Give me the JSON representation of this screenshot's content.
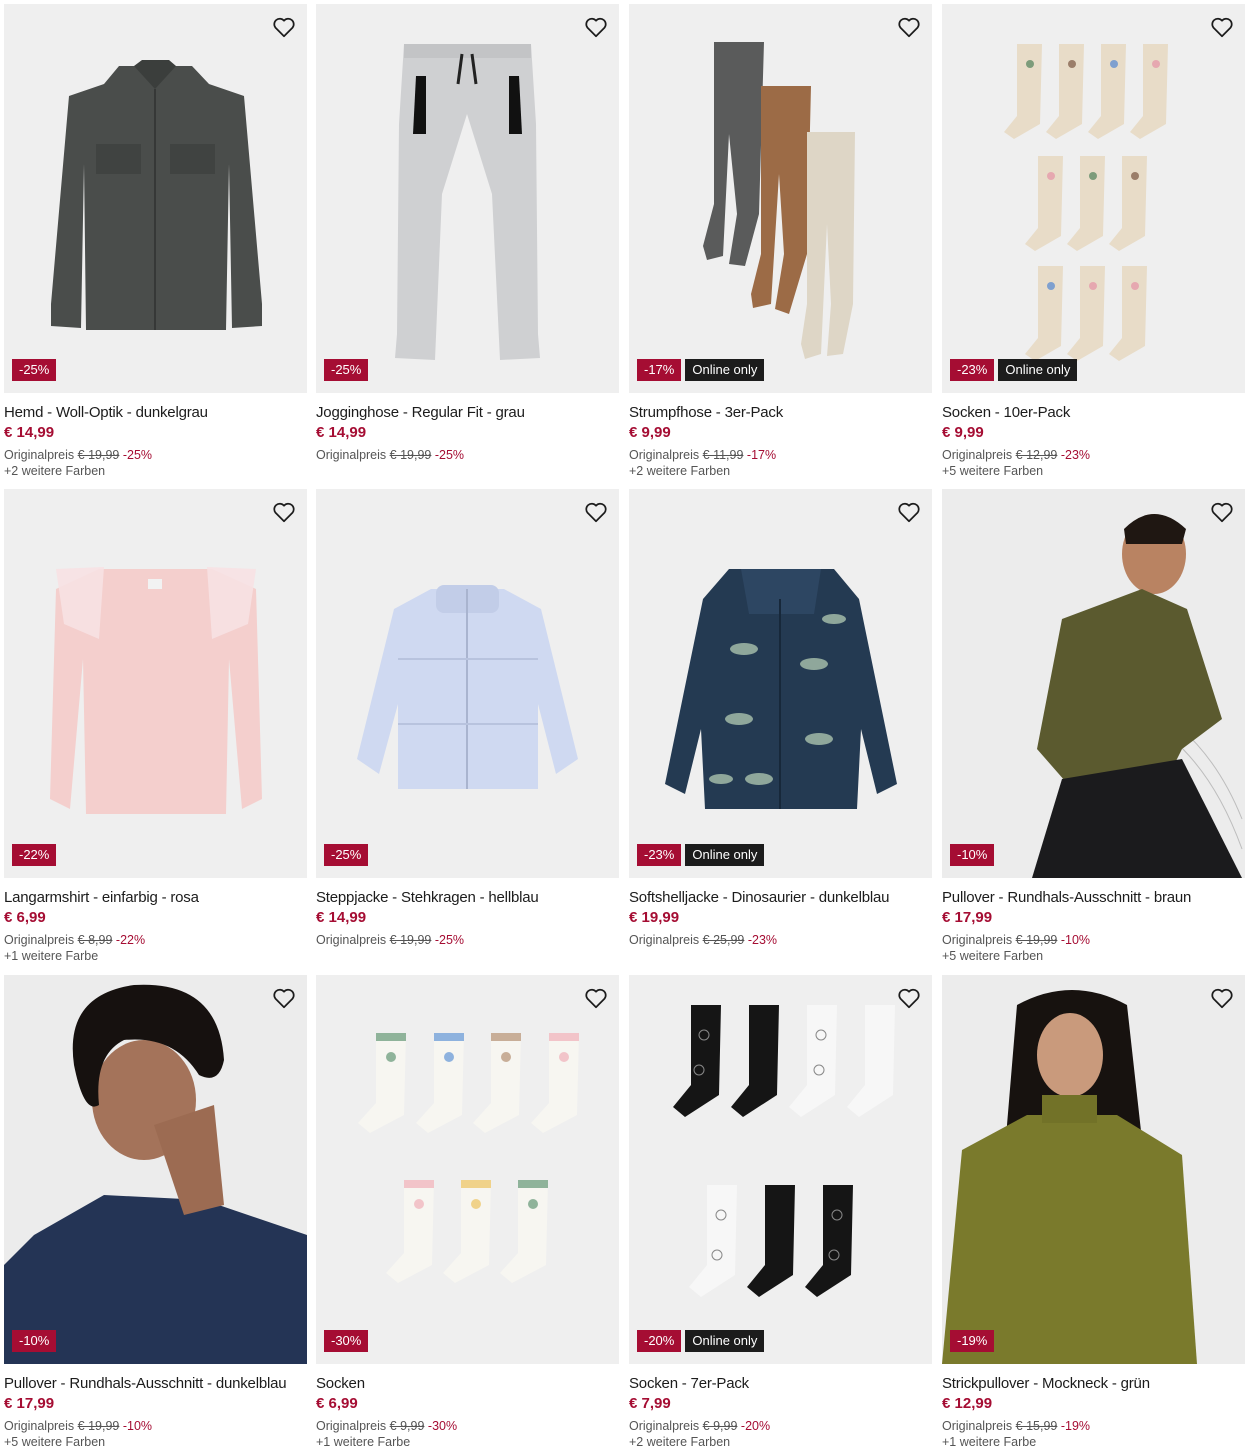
{
  "theme": {
    "accent": "#a50d33",
    "dark": "#1c1c1c",
    "tile_bg": "#f1f1f1"
  },
  "labels": {
    "original_price": "Originalpreis",
    "online_only": "Online only",
    "wishlist_icon": "heart-outline-icon"
  },
  "products": [
    {
      "title": "Hemd - Woll-Optik - dunkelgrau",
      "price": "€ 14,99",
      "orig_price": "€ 19,99",
      "orig_pct": "-25%",
      "badge": "-25%",
      "online_only": false,
      "colors": "+2 weitere Farben",
      "image": "shirt"
    },
    {
      "title": "Jogginghose - Regular Fit - grau",
      "price": "€ 14,99",
      "orig_price": "€ 19,99",
      "orig_pct": "-25%",
      "badge": "-25%",
      "online_only": false,
      "colors": "",
      "image": "pants"
    },
    {
      "title": "Strumpfhose - 3er-Pack",
      "price": "€ 9,99",
      "orig_price": "€ 11,99",
      "orig_pct": "-17%",
      "badge": "-17%",
      "online_only": true,
      "colors": "+2 weitere Farben",
      "image": "tights"
    },
    {
      "title": "Socken - 10er-Pack",
      "price": "€ 9,99",
      "orig_price": "€ 12,99",
      "orig_pct": "-23%",
      "badge": "-23%",
      "online_only": true,
      "colors": "+5 weitere Farben",
      "image": "socks10"
    },
    {
      "title": "Langarmshirt - einfarbig - rosa",
      "price": "€ 6,99",
      "orig_price": "€ 8,99",
      "orig_pct": "-22%",
      "badge": "-22%",
      "online_only": false,
      "colors": "+1 weitere Farbe",
      "image": "longsleeve"
    },
    {
      "title": "Steppjacke - Stehkragen - hellblau",
      "price": "€ 14,99",
      "orig_price": "€ 19,99",
      "orig_pct": "-25%",
      "badge": "-25%",
      "online_only": false,
      "colors": "",
      "image": "puffer"
    },
    {
      "title": "Softshelljacke - Dinosaurier - dunkelblau",
      "price": "€ 19,99",
      "orig_price": "€ 25,99",
      "orig_pct": "-23%",
      "badge": "-23%",
      "online_only": true,
      "colors": "",
      "image": "softshell"
    },
    {
      "title": "Pullover - Rundhals-Ausschnitt - braun",
      "price": "€ 17,99",
      "orig_price": "€ 19,99",
      "orig_pct": "-10%",
      "badge": "-10%",
      "online_only": false,
      "colors": "+5 weitere Farben",
      "image": "model-brown"
    },
    {
      "title": "Pullover - Rundhals-Ausschnitt - dunkelblau",
      "price": "€ 17,99",
      "orig_price": "€ 19,99",
      "orig_pct": "-10%",
      "badge": "-10%",
      "online_only": false,
      "colors": "+5 weitere Farben",
      "image": "model-blue"
    },
    {
      "title": "Socken",
      "price": "€ 6,99",
      "orig_price": "€ 9,99",
      "orig_pct": "-30%",
      "badge": "-30%",
      "online_only": false,
      "colors": "+1 weitere Farbe",
      "image": "socks-white"
    },
    {
      "title": "Socken - 7er-Pack",
      "price": "€ 7,99",
      "orig_price": "€ 9,99",
      "orig_pct": "-20%",
      "badge": "-20%",
      "online_only": true,
      "colors": "+2 weitere Farben",
      "image": "socks-cats"
    },
    {
      "title": "Strickpullover - Mockneck - grün",
      "price": "€ 12,99",
      "orig_price": "€ 15,99",
      "orig_pct": "-19%",
      "badge": "-19%",
      "online_only": false,
      "colors": "+1 weitere Farbe",
      "image": "model-green"
    }
  ]
}
